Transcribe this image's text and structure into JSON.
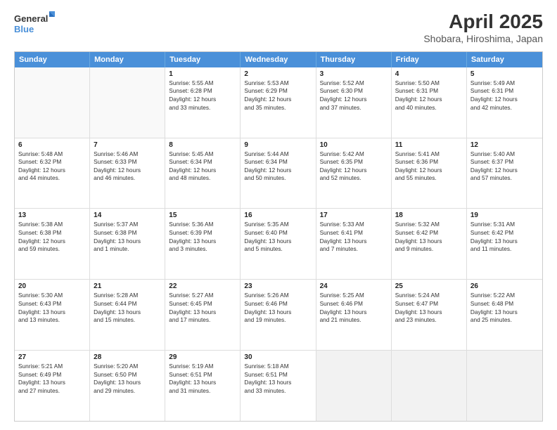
{
  "header": {
    "logo_line1": "General",
    "logo_line2": "Blue",
    "main_title": "April 2025",
    "sub_title": "Shobara, Hiroshima, Japan"
  },
  "days": [
    "Sunday",
    "Monday",
    "Tuesday",
    "Wednesday",
    "Thursday",
    "Friday",
    "Saturday"
  ],
  "rows": [
    [
      {
        "day": "",
        "lines": []
      },
      {
        "day": "",
        "lines": []
      },
      {
        "day": "1",
        "lines": [
          "Sunrise: 5:55 AM",
          "Sunset: 6:28 PM",
          "Daylight: 12 hours",
          "and 33 minutes."
        ]
      },
      {
        "day": "2",
        "lines": [
          "Sunrise: 5:53 AM",
          "Sunset: 6:29 PM",
          "Daylight: 12 hours",
          "and 35 minutes."
        ]
      },
      {
        "day": "3",
        "lines": [
          "Sunrise: 5:52 AM",
          "Sunset: 6:30 PM",
          "Daylight: 12 hours",
          "and 37 minutes."
        ]
      },
      {
        "day": "4",
        "lines": [
          "Sunrise: 5:50 AM",
          "Sunset: 6:31 PM",
          "Daylight: 12 hours",
          "and 40 minutes."
        ]
      },
      {
        "day": "5",
        "lines": [
          "Sunrise: 5:49 AM",
          "Sunset: 6:31 PM",
          "Daylight: 12 hours",
          "and 42 minutes."
        ]
      }
    ],
    [
      {
        "day": "6",
        "lines": [
          "Sunrise: 5:48 AM",
          "Sunset: 6:32 PM",
          "Daylight: 12 hours",
          "and 44 minutes."
        ]
      },
      {
        "day": "7",
        "lines": [
          "Sunrise: 5:46 AM",
          "Sunset: 6:33 PM",
          "Daylight: 12 hours",
          "and 46 minutes."
        ]
      },
      {
        "day": "8",
        "lines": [
          "Sunrise: 5:45 AM",
          "Sunset: 6:34 PM",
          "Daylight: 12 hours",
          "and 48 minutes."
        ]
      },
      {
        "day": "9",
        "lines": [
          "Sunrise: 5:44 AM",
          "Sunset: 6:34 PM",
          "Daylight: 12 hours",
          "and 50 minutes."
        ]
      },
      {
        "day": "10",
        "lines": [
          "Sunrise: 5:42 AM",
          "Sunset: 6:35 PM",
          "Daylight: 12 hours",
          "and 52 minutes."
        ]
      },
      {
        "day": "11",
        "lines": [
          "Sunrise: 5:41 AM",
          "Sunset: 6:36 PM",
          "Daylight: 12 hours",
          "and 55 minutes."
        ]
      },
      {
        "day": "12",
        "lines": [
          "Sunrise: 5:40 AM",
          "Sunset: 6:37 PM",
          "Daylight: 12 hours",
          "and 57 minutes."
        ]
      }
    ],
    [
      {
        "day": "13",
        "lines": [
          "Sunrise: 5:38 AM",
          "Sunset: 6:38 PM",
          "Daylight: 12 hours",
          "and 59 minutes."
        ]
      },
      {
        "day": "14",
        "lines": [
          "Sunrise: 5:37 AM",
          "Sunset: 6:38 PM",
          "Daylight: 13 hours",
          "and 1 minute."
        ]
      },
      {
        "day": "15",
        "lines": [
          "Sunrise: 5:36 AM",
          "Sunset: 6:39 PM",
          "Daylight: 13 hours",
          "and 3 minutes."
        ]
      },
      {
        "day": "16",
        "lines": [
          "Sunrise: 5:35 AM",
          "Sunset: 6:40 PM",
          "Daylight: 13 hours",
          "and 5 minutes."
        ]
      },
      {
        "day": "17",
        "lines": [
          "Sunrise: 5:33 AM",
          "Sunset: 6:41 PM",
          "Daylight: 13 hours",
          "and 7 minutes."
        ]
      },
      {
        "day": "18",
        "lines": [
          "Sunrise: 5:32 AM",
          "Sunset: 6:42 PM",
          "Daylight: 13 hours",
          "and 9 minutes."
        ]
      },
      {
        "day": "19",
        "lines": [
          "Sunrise: 5:31 AM",
          "Sunset: 6:42 PM",
          "Daylight: 13 hours",
          "and 11 minutes."
        ]
      }
    ],
    [
      {
        "day": "20",
        "lines": [
          "Sunrise: 5:30 AM",
          "Sunset: 6:43 PM",
          "Daylight: 13 hours",
          "and 13 minutes."
        ]
      },
      {
        "day": "21",
        "lines": [
          "Sunrise: 5:28 AM",
          "Sunset: 6:44 PM",
          "Daylight: 13 hours",
          "and 15 minutes."
        ]
      },
      {
        "day": "22",
        "lines": [
          "Sunrise: 5:27 AM",
          "Sunset: 6:45 PM",
          "Daylight: 13 hours",
          "and 17 minutes."
        ]
      },
      {
        "day": "23",
        "lines": [
          "Sunrise: 5:26 AM",
          "Sunset: 6:46 PM",
          "Daylight: 13 hours",
          "and 19 minutes."
        ]
      },
      {
        "day": "24",
        "lines": [
          "Sunrise: 5:25 AM",
          "Sunset: 6:46 PM",
          "Daylight: 13 hours",
          "and 21 minutes."
        ]
      },
      {
        "day": "25",
        "lines": [
          "Sunrise: 5:24 AM",
          "Sunset: 6:47 PM",
          "Daylight: 13 hours",
          "and 23 minutes."
        ]
      },
      {
        "day": "26",
        "lines": [
          "Sunrise: 5:22 AM",
          "Sunset: 6:48 PM",
          "Daylight: 13 hours",
          "and 25 minutes."
        ]
      }
    ],
    [
      {
        "day": "27",
        "lines": [
          "Sunrise: 5:21 AM",
          "Sunset: 6:49 PM",
          "Daylight: 13 hours",
          "and 27 minutes."
        ]
      },
      {
        "day": "28",
        "lines": [
          "Sunrise: 5:20 AM",
          "Sunset: 6:50 PM",
          "Daylight: 13 hours",
          "and 29 minutes."
        ]
      },
      {
        "day": "29",
        "lines": [
          "Sunrise: 5:19 AM",
          "Sunset: 6:51 PM",
          "Daylight: 13 hours",
          "and 31 minutes."
        ]
      },
      {
        "day": "30",
        "lines": [
          "Sunrise: 5:18 AM",
          "Sunset: 6:51 PM",
          "Daylight: 13 hours",
          "and 33 minutes."
        ]
      },
      {
        "day": "",
        "lines": []
      },
      {
        "day": "",
        "lines": []
      },
      {
        "day": "",
        "lines": []
      }
    ]
  ]
}
